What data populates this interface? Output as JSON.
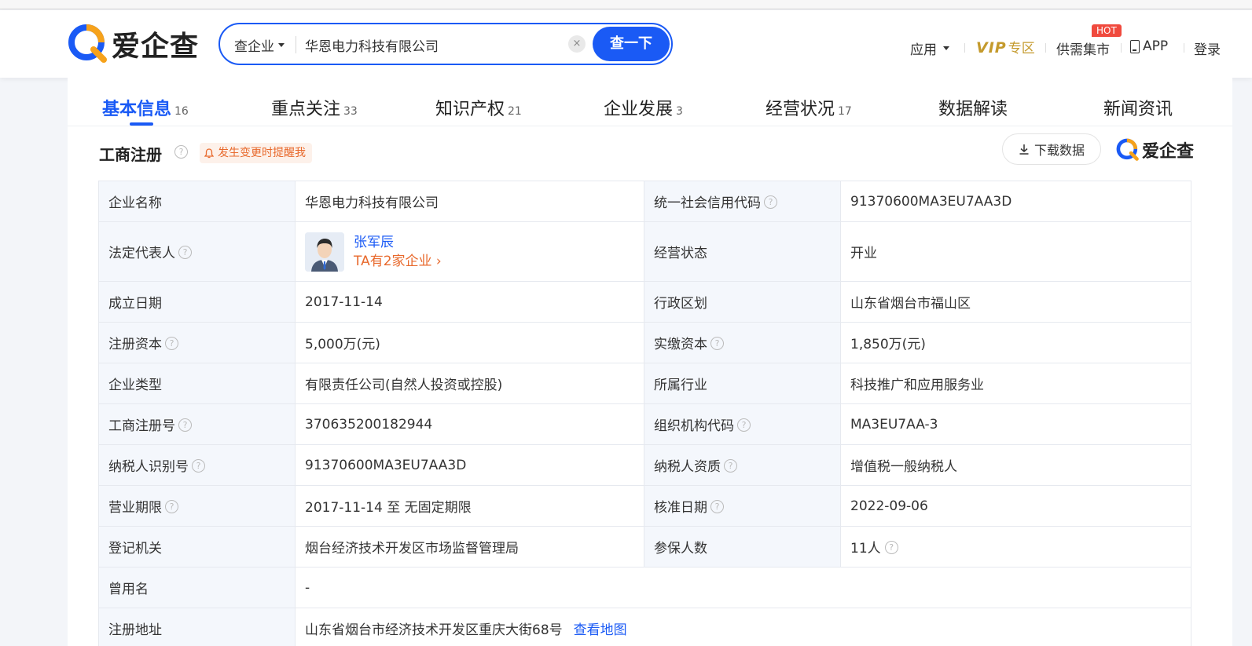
{
  "header": {
    "logo_text": "爱企查",
    "search": {
      "type_label": "查企业",
      "value": "华恩电力科技有限公司",
      "clear_label": "×",
      "button_label": "查一下"
    },
    "nav": {
      "app": "应用",
      "vip_logo": "VIP",
      "vip_text": "专区",
      "market": "供需集市",
      "hot_badge": "HOT",
      "app_download": "APP",
      "login": "登录"
    }
  },
  "tabs": [
    {
      "label": "基本信息",
      "count": "16"
    },
    {
      "label": "重点关注",
      "count": "33"
    },
    {
      "label": "知识产权",
      "count": "21"
    },
    {
      "label": "企业发展",
      "count": "3"
    },
    {
      "label": "经营状况",
      "count": "17"
    },
    {
      "label": "数据解读",
      "count": ""
    },
    {
      "label": "新闻资讯",
      "count": ""
    }
  ],
  "section": {
    "title": "工商注册",
    "help": "?",
    "remind_label": "发生变更时提醒我",
    "download_label": "下载数据",
    "brand_text": "爱企查"
  },
  "info": {
    "company_name_label": "企业名称",
    "company_name": "华恩电力科技有限公司",
    "credit_code_label": "统一社会信用代码",
    "credit_code": "91370600MA3EU7AA3D",
    "legal_rep_label": "法定代表人",
    "legal_rep_name": "张军辰",
    "legal_rep_more": "TA有2家企业",
    "status_label": "经营状态",
    "status": "开业",
    "found_date_label": "成立日期",
    "found_date": "2017-11-14",
    "region_label": "行政区划",
    "region": "山东省烟台市福山区",
    "reg_capital_label": "注册资本",
    "reg_capital": "5,000万(元)",
    "paid_capital_label": "实缴资本",
    "paid_capital": "1,850万(元)",
    "company_type_label": "企业类型",
    "company_type": "有限责任公司(自然人投资或控股)",
    "industry_label": "所属行业",
    "industry": "科技推广和应用服务业",
    "reg_no_label": "工商注册号",
    "reg_no": "370635200182944",
    "org_code_label": "组织机构代码",
    "org_code": "MA3EU7AA-3",
    "taxpayer_id_label": "纳税人识别号",
    "taxpayer_id": "91370600MA3EU7AA3D",
    "taxpayer_qual_label": "纳税人资质",
    "taxpayer_qual": "增值税一般纳税人",
    "term_label": "营业期限",
    "term": "2017-11-14 至 无固定期限",
    "approve_date_label": "核准日期",
    "approve_date": "2022-09-06",
    "authority_label": "登记机关",
    "authority": "烟台经济技术开发区市场监督管理局",
    "insured_label": "参保人数",
    "insured": "11人",
    "former_name_label": "曾用名",
    "former_name": "-",
    "address_label": "注册地址",
    "address": "山东省烟台市经济技术开发区重庆大街68号",
    "map_link": "查看地图"
  }
}
